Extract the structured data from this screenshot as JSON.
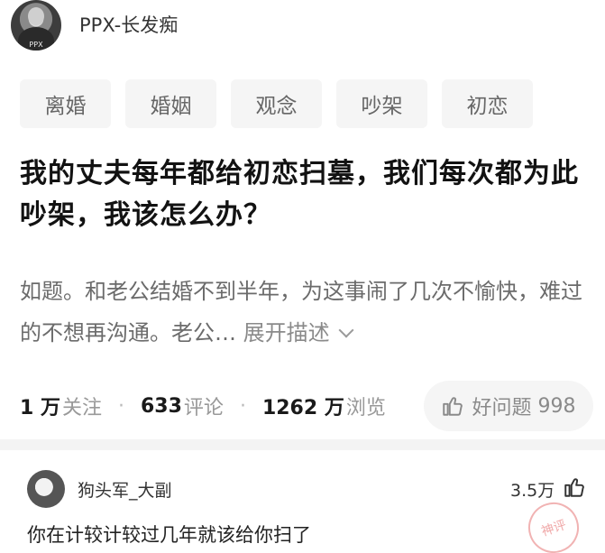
{
  "post": {
    "author": "PPX-长发痴",
    "avatar_label": "PPX",
    "tags": [
      "离婚",
      "婚姻",
      "观念",
      "吵架",
      "初恋"
    ],
    "title": "我的丈夫每年都给初恋扫墓，我们每次都为此吵架，我该怎么办？",
    "description": "如题。和老公结婚不到半年，为这事闹了几次不愉快，难过的不想再沟通。老公…",
    "expand_label": "展开描述",
    "stats": {
      "follow_count": "1 万",
      "follow_label": "关注",
      "comment_count": "633",
      "comment_label": "评论",
      "view_count": "1262 万",
      "view_label": "浏览"
    },
    "good_question": {
      "label": "好问题",
      "count": "998"
    }
  },
  "comment": {
    "author": "狗头军_大副",
    "likes": "3.5万",
    "text": "你在计较计较过几年就该给你扫了",
    "watermark": "神评"
  },
  "colors": {
    "chip_bg": "#f5f5f5",
    "divider": "#f3f3f3",
    "stamp": "#f0a9a9"
  },
  "icons": [
    "like-icon",
    "chevron-down-icon",
    "thumb-up-icon"
  ]
}
